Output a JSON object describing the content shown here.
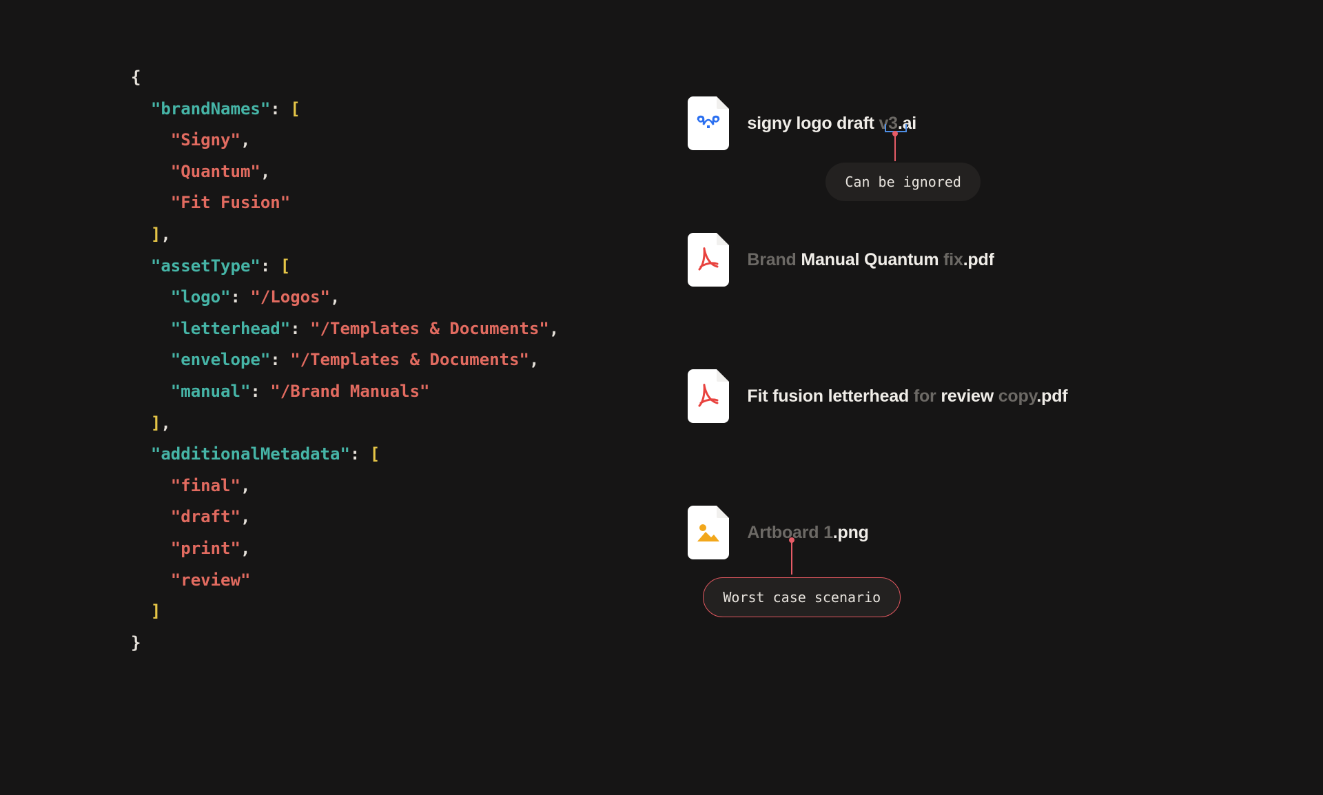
{
  "code": {
    "keys": {
      "brandNames": "\"brandNames\"",
      "assetType": "\"assetType\"",
      "additionalMetadata": "\"additionalMetadata\""
    },
    "brandNames": {
      "v0": "\"Signy\"",
      "v1": "\"Quantum\"",
      "v2": "\"Fit Fusion\""
    },
    "assetType": {
      "k0": "\"logo\"",
      "p0": "\"/Logos\"",
      "k1": "\"letterhead\"",
      "p1": "\"/Templates & Documents\"",
      "k2": "\"envelope\"",
      "p2": "\"/Templates & Documents\"",
      "k3": "\"manual\"",
      "p3": "\"/Brand Manuals\""
    },
    "additionalMetadata": {
      "v0": "\"final\"",
      "v1": "\"draft\"",
      "v2": "\"print\"",
      "v3": "\"review\""
    }
  },
  "files": {
    "f0": {
      "p0": "signy logo draft ",
      "p1": "v3",
      "p2": ".ai"
    },
    "f1": {
      "p0": "Brand ",
      "p1": "Manual Quantum ",
      "p2": "fix",
      "p3": ".pdf"
    },
    "f2": {
      "p0": "Fit fusion letterhead ",
      "p1": "for ",
      "p2": "review ",
      "p3": "copy",
      "p4": ".pdf"
    },
    "f3": {
      "p0": "Artboard 1",
      "p1": ".png"
    }
  },
  "annotations": {
    "ignored": "Can be ignored",
    "worst": "Worst case scenario"
  }
}
